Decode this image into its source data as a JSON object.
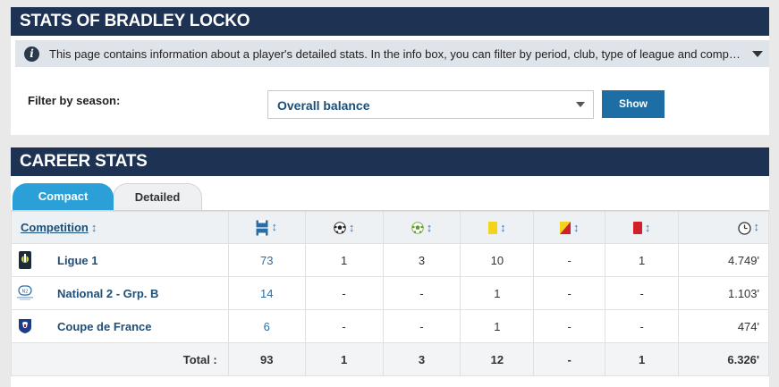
{
  "page_title": "STATS OF BRADLEY LOCKO",
  "info": {
    "text": "This page contains information about a player's detailed stats. In the info box, you can filter by period, club, type of league and competition. Th..."
  },
  "filter": {
    "label": "Filter by season:",
    "selected": "Overall balance",
    "button": "Show"
  },
  "career": {
    "title": "CAREER STATS",
    "tabs": [
      "Compact",
      "Detailed"
    ],
    "headers": {
      "competition": "Competition",
      "sort_glyph": "↕",
      "icons": [
        "appearances-icon",
        "goals-icon",
        "assists-icon",
        "yellow-card-icon",
        "second-yellow-icon",
        "red-card-icon",
        "minutes-icon"
      ]
    },
    "rows": [
      {
        "logo": "ligue1-logo",
        "name": "Ligue 1",
        "apps": "73",
        "goals": "1",
        "assists": "3",
        "yellow": "10",
        "yellow_red": "-",
        "red": "1",
        "minutes": "4.749'"
      },
      {
        "logo": "national2-logo",
        "name": "National 2 - Grp. B",
        "apps": "14",
        "goals": "-",
        "assists": "-",
        "yellow": "1",
        "yellow_red": "-",
        "red": "-",
        "minutes": "1.103'"
      },
      {
        "logo": "coupe-de-france-logo",
        "name": "Coupe de France",
        "apps": "6",
        "goals": "-",
        "assists": "-",
        "yellow": "1",
        "yellow_red": "-",
        "red": "-",
        "minutes": "474'"
      }
    ],
    "total": {
      "label": "Total :",
      "apps": "93",
      "goals": "1",
      "assists": "3",
      "yellow": "12",
      "yellow_red": "-",
      "red": "1",
      "minutes": "6.326'"
    }
  },
  "colors": {
    "header_bg": "#1e3354",
    "accent_tab": "#2a9fd8",
    "button": "#1c6ea4",
    "yellow_card": "#f4d31b",
    "red_card": "#d0202a"
  }
}
